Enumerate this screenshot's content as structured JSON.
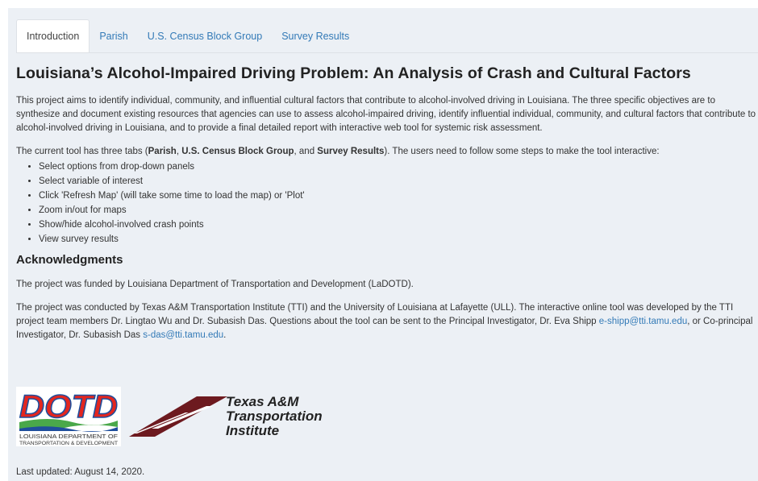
{
  "tabs": [
    {
      "label": "Introduction",
      "active": true
    },
    {
      "label": "Parish",
      "active": false
    },
    {
      "label": "U.S. Census Block Group",
      "active": false
    },
    {
      "label": "Survey Results",
      "active": false
    }
  ],
  "title": "Louisiana’s Alcohol-Impaired Driving Problem: An Analysis of Crash and Cultural Factors",
  "intro_paragraph": "This project aims to identify individual, community, and influential cultural factors that contribute to alcohol-involved driving in Louisiana. The three specific objectives are to synthesize and document existing resources that agencies can use to assess alcohol-impaired driving, identify influential individual, community, and cultural factors that contribute to alcohol-involved driving in Louisiana, and to provide a final detailed report with interactive web tool for systemic risk assessment.",
  "tool_paragraph": {
    "before": "The current tool has three tabs (",
    "tab1": "Parish",
    "sep1": ", ",
    "tab2": "U.S. Census Block Group",
    "sep2": ", and ",
    "tab3": "Survey Results",
    "after": "). The users need to follow some steps to make the tool interactive:"
  },
  "steps": [
    "Select options from drop-down panels",
    "Select variable of interest",
    "Click 'Refresh Map' (will take some time to load the map) or 'Plot'",
    "Zoom in/out for maps",
    "Show/hide alcohol-involved crash points",
    "View survey results"
  ],
  "acknowledgments_heading": "Acknowledgments",
  "funding_paragraph": "The project was funded by Louisiana Department of Transportation and Development (LaDOTD).",
  "conducted_paragraph": {
    "text1": "The project was conducted by Texas A&M Transportation Institute (TTI) and the University of Louisiana at Lafayette (ULL). The interactive online tool was developed by the TTI project team members Dr. Lingtao Wu and Dr. Subasish Das. Questions about the tool can be sent to the Principal Investigator, Dr. Eva Shipp ",
    "email1": "e-shipp@tti.tamu.edu",
    "text2": ", or Co-principal Investigator, Dr. Subasish Das ",
    "email2": "s-das@tti.tamu.edu",
    "text3": "."
  },
  "logos": {
    "dotd": {
      "main": "DOTD",
      "line1": "LOUISIANA DEPARTMENT OF",
      "line2": "TRANSPORTATION & DEVELOPMENT"
    },
    "tti": {
      "line1": "Texas A&M",
      "line2": "Transportation",
      "line3": "Institute"
    }
  },
  "last_updated": "Last updated: August 14, 2020.",
  "colors": {
    "page_bg": "#ecf0f5",
    "link": "#337ab7",
    "dotd_red": "#e3261f",
    "dotd_blue": "#1f4e9c",
    "dotd_green": "#4aa84a",
    "tti_maroon": "#6d1a1f"
  }
}
